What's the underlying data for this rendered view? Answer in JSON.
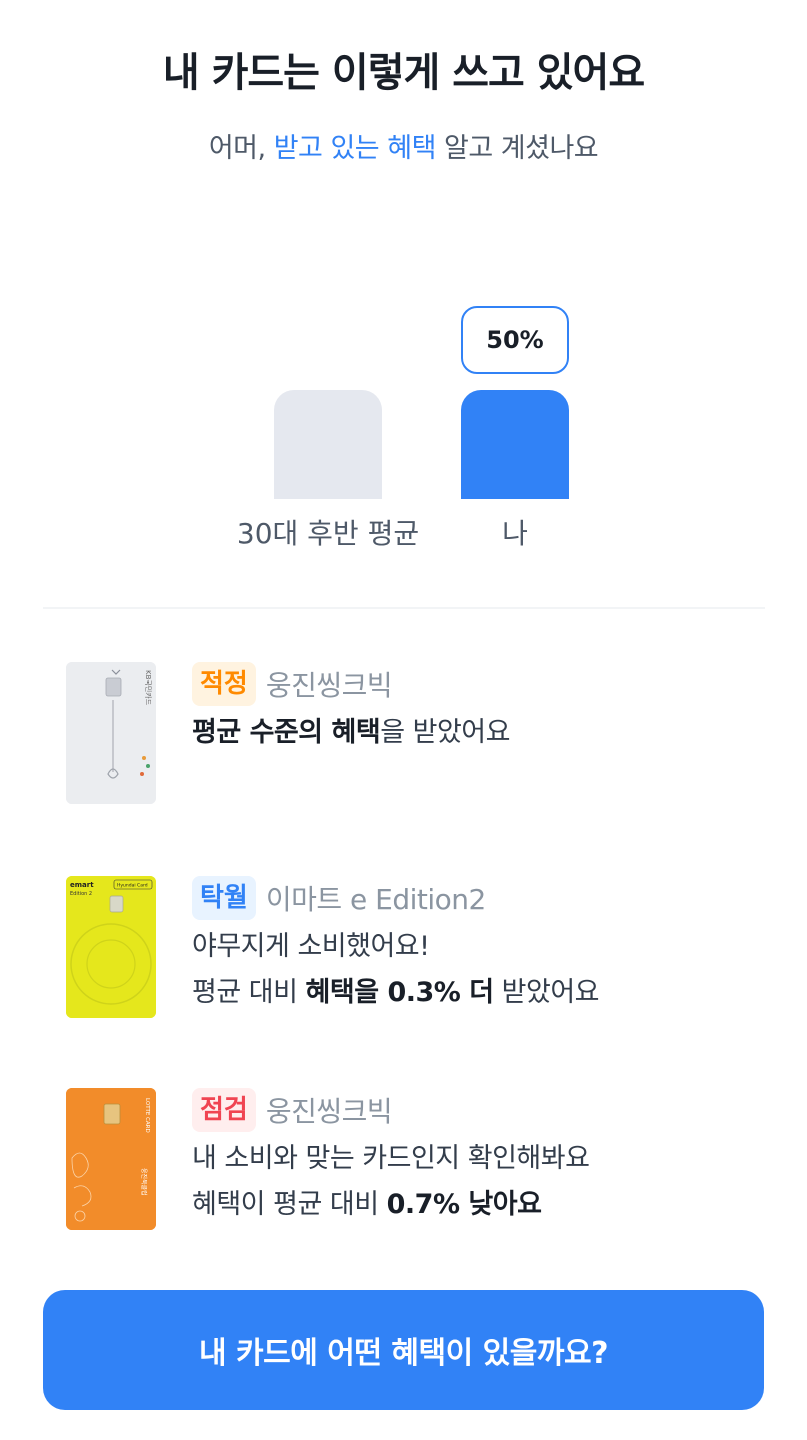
{
  "header": {
    "title": "내 카드는 이렇게 쓰고 있어요",
    "subtitle_pre": "어머, ",
    "subtitle_highlight": "받고 있는 혜택",
    "subtitle_post": " 알고 계셨나요"
  },
  "comparison": {
    "bubble": "50%",
    "bars": [
      {
        "label": "30대 후반 평균",
        "level": 0.26
      },
      {
        "label": "나",
        "level": 0.26
      }
    ]
  },
  "cards": [
    {
      "badge": "적정",
      "name": "웅진씽크빅",
      "line1_bold": "평균 수준의 혜택",
      "line1_rest": "을 받았어요",
      "card_brand": "KB국민카드",
      "card_color": "#ebedf3"
    },
    {
      "badge": "탁월",
      "name": "이마트 e Edition2",
      "line1": "야무지게 소비했어요!",
      "line2_pre": "평균 대비 ",
      "line2_bold": "혜택을 0.3% 더",
      "line2_post": " 받았어요",
      "card_brand": "emart",
      "card_sub": "Edition 2",
      "card_tag": "Hyundai Card",
      "card_color": "#e5e71c"
    },
    {
      "badge": "점검",
      "name": "웅진씽크빅",
      "line1": "내 소비와 맞는 카드인지 확인해봐요",
      "line2_pre": "혜택이 평균 대비 ",
      "line2_bold": "0.7% 낮아요",
      "card_brand": "LOTTE CARD",
      "card_sub": "웅진북클럽",
      "card_color": "#f28c2a"
    }
  ],
  "cta": {
    "label": "내 카드에 어떤 혜택이 있을까요?"
  },
  "colors": {
    "accent": "#3182f6",
    "bar_avg": "#e5e8ef",
    "text": "#191f28"
  }
}
